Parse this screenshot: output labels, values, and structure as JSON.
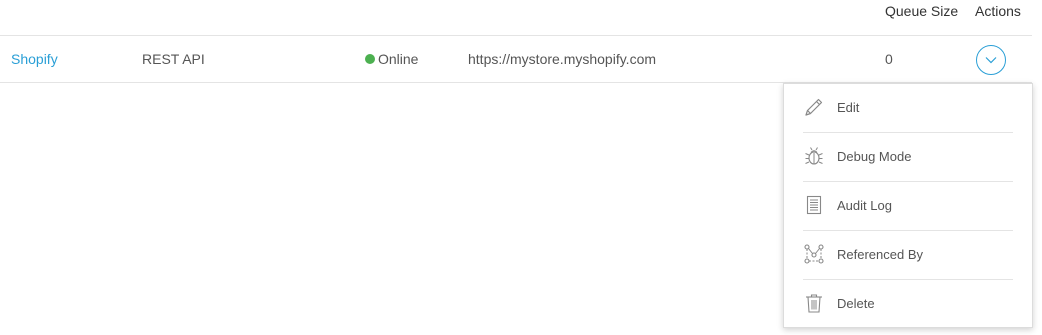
{
  "table": {
    "headers": {
      "queue_size": "Queue Size",
      "actions": "Actions"
    },
    "row": {
      "name": "Shopify",
      "type": "REST API",
      "status": "Online",
      "url": "https://mystore.myshopify.com",
      "queue_size": "0"
    }
  },
  "actions_menu": {
    "items": [
      {
        "label": "Edit",
        "icon": "pencil-icon"
      },
      {
        "label": "Debug Mode",
        "icon": "bug-icon"
      },
      {
        "label": "Audit Log",
        "icon": "document-list-icon"
      },
      {
        "label": "Referenced By",
        "icon": "network-nodes-icon"
      },
      {
        "label": "Delete",
        "icon": "trash-icon"
      }
    ]
  },
  "colors": {
    "link": "#2a9fd6",
    "status_online": "#4cb050",
    "toggle_border": "#2a9fd6",
    "icon_gray": "#888888"
  }
}
